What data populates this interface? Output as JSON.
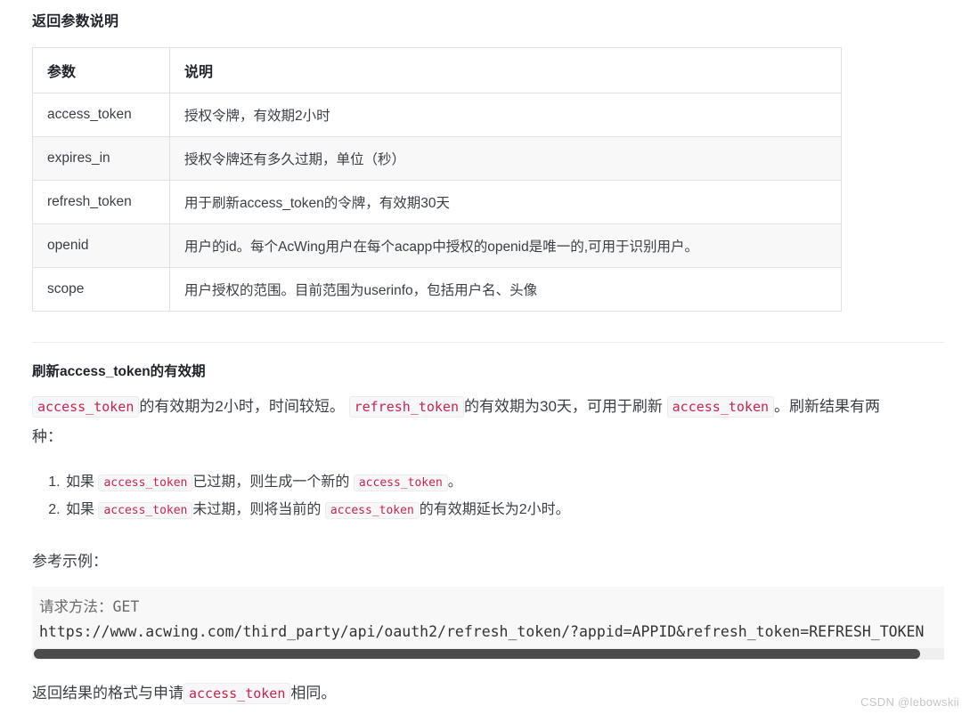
{
  "section": {
    "title": "返回参数说明"
  },
  "table": {
    "headers": [
      "参数",
      "说明"
    ],
    "rows": [
      {
        "param": "access_token",
        "desc": "授权令牌，有效期2小时"
      },
      {
        "param": "expires_in",
        "desc": "授权令牌还有多久过期，单位（秒）"
      },
      {
        "param": "refresh_token",
        "desc": "用于刷新access_token的令牌，有效期30天"
      },
      {
        "param": "openid",
        "desc": "用户的id。每个AcWing用户在每个acapp中授权的openid是唯一的,可用于识别用户。"
      },
      {
        "param": "scope",
        "desc": "用户授权的范围。目前范围为userinfo，包括用户名、头像"
      }
    ]
  },
  "refresh_section": {
    "title": "刷新access_token的有效期",
    "paragraph": {
      "code1": "access_token",
      "text1": "的有效期为2小时，时间较短。",
      "code2": "refresh_token",
      "text2": "的有效期为30天，可用于刷新",
      "code3": "access_token",
      "text3": "。刷新结果有两种："
    },
    "steps": [
      {
        "text1": "如果",
        "code1": "access_token",
        "text2": "已过期，则生成一个新的",
        "code2": "access_token",
        "text3": "。"
      },
      {
        "text1": "如果",
        "code1": "access_token",
        "text2": "未过期，则将当前的",
        "code2": "access_token",
        "text3": "的有效期延长为2小时。"
      }
    ]
  },
  "example": {
    "label": "参考示例：",
    "code_line_1": "请求方法：GET",
    "code_line_2": "https://www.acwing.com/third_party/api/oauth2/refresh_token/?appid=APPID&refresh_token=REFRESH_TOKEN"
  },
  "final": {
    "text1": "返回结果的格式与申请",
    "code1": "access_token",
    "text2": "相同。"
  },
  "watermark": {
    "text": "CSDN @lebowskii"
  },
  "colors": {
    "inline_code": "#c7254e",
    "inline_code_bg": "#f7f7f9",
    "table_border": "#dfe2e5",
    "row_alt_bg": "#f8f8f8",
    "codeblock_bg": "#f8f8f8",
    "scrollbar_thumb": "#4b4b4b",
    "text": "#3b3f45"
  }
}
